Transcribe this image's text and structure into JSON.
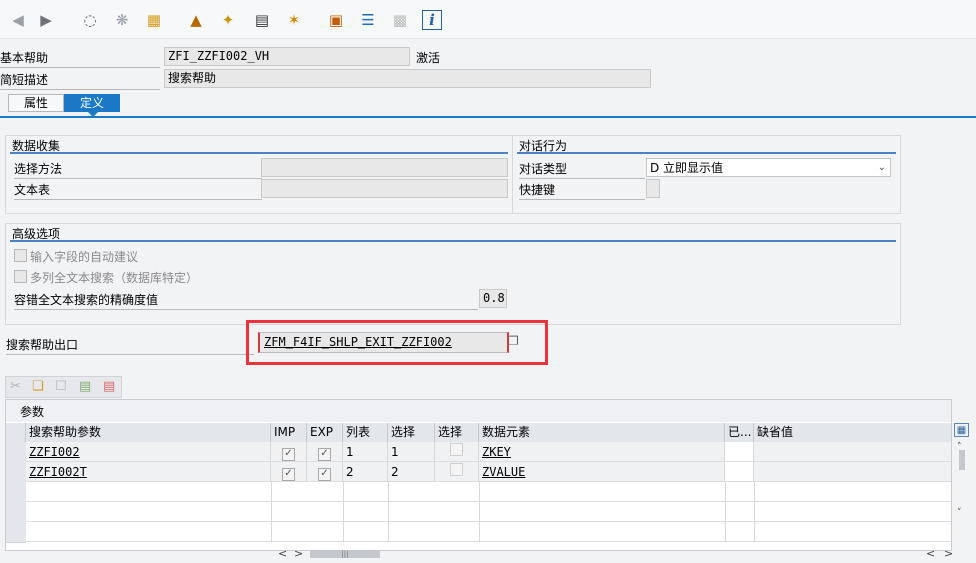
{
  "toolbar": {
    "icons": [
      "back-arrow-icon",
      "forward-arrow-icon",
      "glasses-icon",
      "other-object-icon",
      "activate-icon",
      "hierarchy-icon",
      "magic-wand-icon",
      "where-used-icon",
      "navigation-icon",
      "hierarchy2-icon",
      "display-object-list-icon",
      "layout-icon",
      "info-icon"
    ]
  },
  "header": {
    "help_label": "基本帮助",
    "help_value": "ZFI_ZZFI002_VH",
    "status": "激活",
    "desc_label": "简短描述",
    "desc_value": "搜索帮助"
  },
  "tabs": [
    {
      "label": "属性"
    },
    {
      "label": "定义"
    }
  ],
  "data_collection": {
    "title": "数据收集",
    "method_label": "选择方法",
    "method_value": "",
    "text_table_label": "文本表",
    "text_table_value": ""
  },
  "dialog": {
    "title": "对话行为",
    "type_label": "对话类型",
    "type_value": "D 立即显示值",
    "hotkey_label": "快捷键",
    "hotkey_value": ""
  },
  "advanced": {
    "title": "高级选项",
    "auto_suggest": "输入字段的自动建议",
    "multi_col": "多列全文本搜索（数据库特定）",
    "fuzzy_label": "容错全文本搜索的精确度值",
    "fuzzy_value": "0.8"
  },
  "exit": {
    "label": "搜索帮助出口",
    "value": "ZFM_F4IF_SHLP_EXIT_ZZFI002"
  },
  "params": {
    "title": "参数",
    "columns": [
      "搜索帮助参数",
      "IMP",
      "EXP",
      "列表",
      "选择",
      "选择",
      "数据元素",
      "已...",
      "缺省值"
    ],
    "rows": [
      {
        "param": "ZZFI002",
        "imp": "✓",
        "exp": "✓",
        "list": "1",
        "sel": "1",
        "seldisp": "",
        "element": "ZKEY"
      },
      {
        "param": "ZZFI002T",
        "imp": "✓",
        "exp": "✓",
        "list": "2",
        "sel": "2",
        "seldisp": "",
        "element": "ZVALUE"
      }
    ]
  },
  "accent": {
    "tab_active": "#1b78c7",
    "highlight": "#e8343a",
    "group_line": "#4a82c3"
  }
}
